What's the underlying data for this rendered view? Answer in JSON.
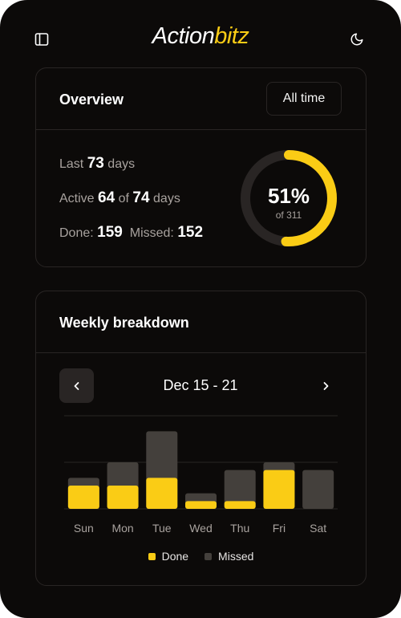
{
  "app": {
    "brand_prefix": "Action",
    "brand_suffix": "bitz",
    "accent_color": "#facc15"
  },
  "header": {
    "sidebar_icon": "sidebar-toggle-icon",
    "theme_icon": "moon-icon"
  },
  "overview": {
    "title": "Overview",
    "filter_label": "All time",
    "last_prefix": "Last",
    "last_days": "73",
    "last_suffix": "days",
    "active_prefix": "Active",
    "active_count": "64",
    "active_of": "of",
    "active_total": "74",
    "active_suffix": "days",
    "done_label": "Done:",
    "done_count": "159",
    "missed_label": "Missed:",
    "missed_count": "152",
    "percent_label": "51%",
    "percent_value": 0.51,
    "total_label": "of 311"
  },
  "weekly": {
    "title": "Weekly breakdown",
    "range_label": "Dec 15 - 21",
    "prev_icon": "chevron-left-icon",
    "next_icon": "chevron-right-icon",
    "legend_done": "Done",
    "legend_missed": "Missed",
    "colors": {
      "done": "#facc15",
      "missed": "#44403c"
    }
  },
  "chart_data": {
    "type": "bar",
    "stacked": true,
    "categories": [
      "Sun",
      "Mon",
      "Tue",
      "Wed",
      "Thu",
      "Fri",
      "Sat"
    ],
    "series": [
      {
        "name": "Done",
        "values": [
          3,
          3,
          4,
          1,
          1,
          5,
          0
        ]
      },
      {
        "name": "Missed",
        "values": [
          1,
          3,
          6,
          1,
          4,
          1,
          5
        ]
      }
    ],
    "ylim": [
      0,
      12
    ],
    "grid": true,
    "legend": "bottom"
  }
}
